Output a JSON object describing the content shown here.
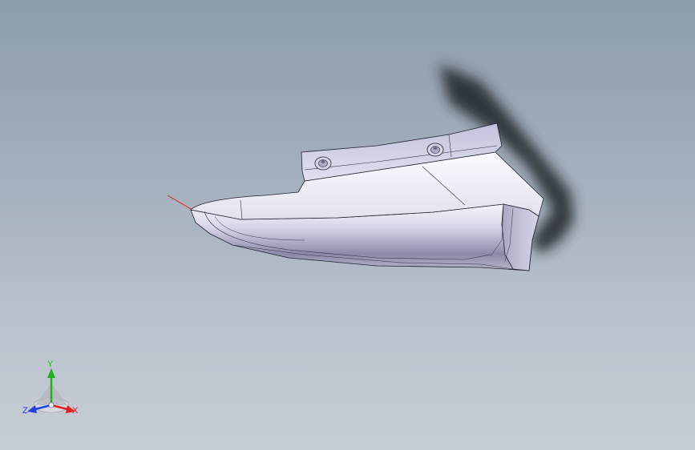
{
  "viewport": {
    "background_top": "#8d9cab",
    "background_bottom": "#c7cdd6",
    "part_color": "#e4e4f2",
    "part_shade": "#8e8ea8",
    "shadow_color": "#1e2124"
  },
  "triad": {
    "x_label": "X",
    "y_label": "Y",
    "z_label": "Z",
    "x_color": "#e02020",
    "y_color": "#20b020",
    "z_color": "#2040e0"
  }
}
